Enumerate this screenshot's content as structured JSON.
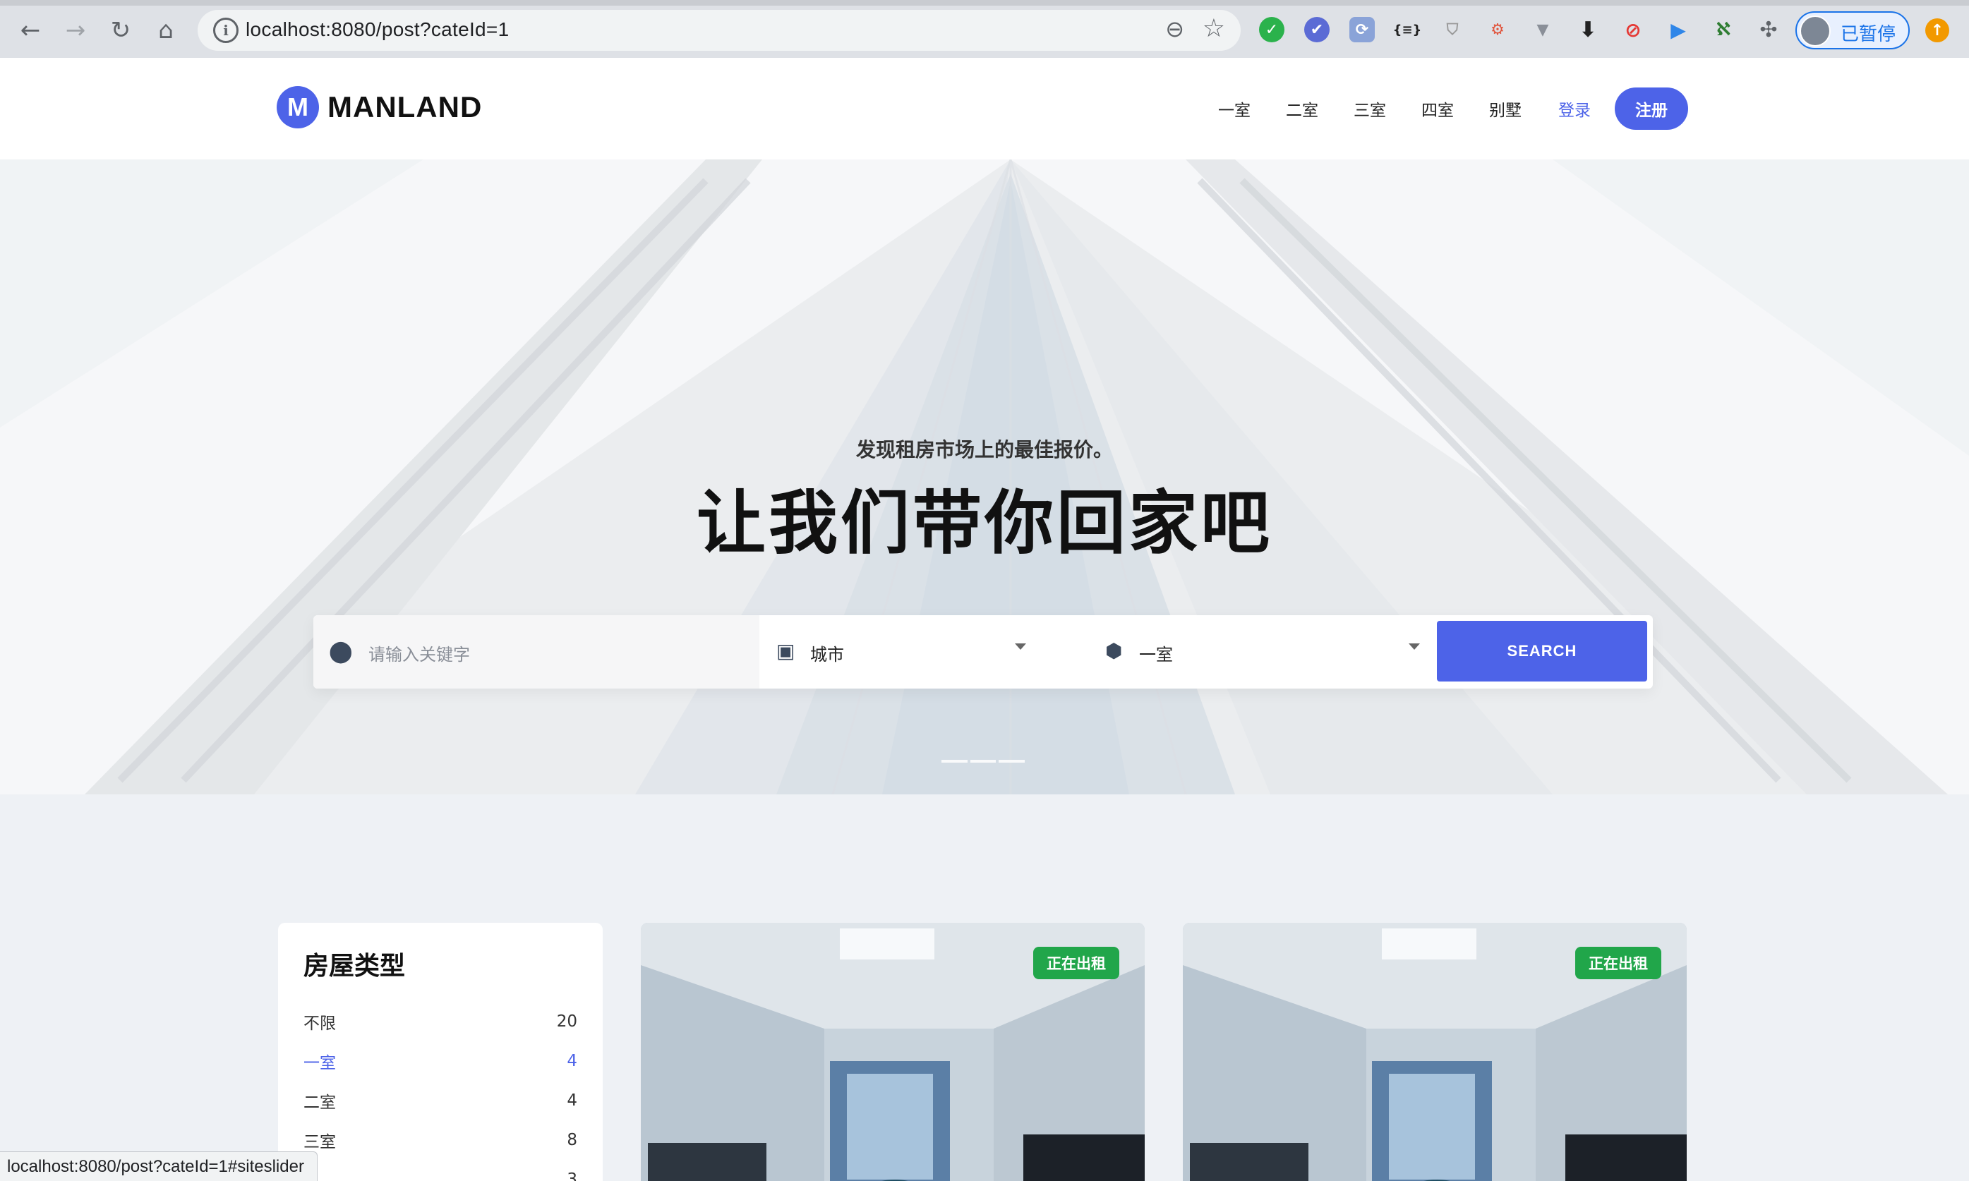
{
  "browser": {
    "url": "localhost:8080/post?cateId=1",
    "profile_label": "已暂停",
    "status_url": "localhost:8080/post?cateId=1#siteslider",
    "icons": [
      "back-icon",
      "forward-icon",
      "reload-icon",
      "home-icon",
      "info-icon",
      "zoom-icon",
      "bookmark-star-icon",
      "extensions-icon"
    ]
  },
  "header": {
    "brand": "MANLAND",
    "brand_mark": "M",
    "nav": [
      "一室",
      "二室",
      "三室",
      "四室",
      "别墅"
    ],
    "login": "登录",
    "register": "注册"
  },
  "hero": {
    "subtitle": "发现租房市场上的最佳报价。",
    "title": "让我们带你回家吧"
  },
  "search": {
    "keyword_placeholder": "请输入关键字",
    "city_value": "城市",
    "room_value": "一室",
    "button": "SEARCH"
  },
  "sidebar": {
    "title": "房屋类型",
    "categories": [
      {
        "label": "不限",
        "count": "20"
      },
      {
        "label": "一室",
        "count": "4"
      },
      {
        "label": "二室",
        "count": "4"
      },
      {
        "label": "三室",
        "count": "8"
      },
      {
        "label": "",
        "count": "3"
      }
    ]
  },
  "listings": [
    {
      "badge": "正在出租"
    },
    {
      "badge": "正在出租"
    }
  ],
  "colors": {
    "accent": "#4d63e8",
    "badge": "#21a64a"
  }
}
